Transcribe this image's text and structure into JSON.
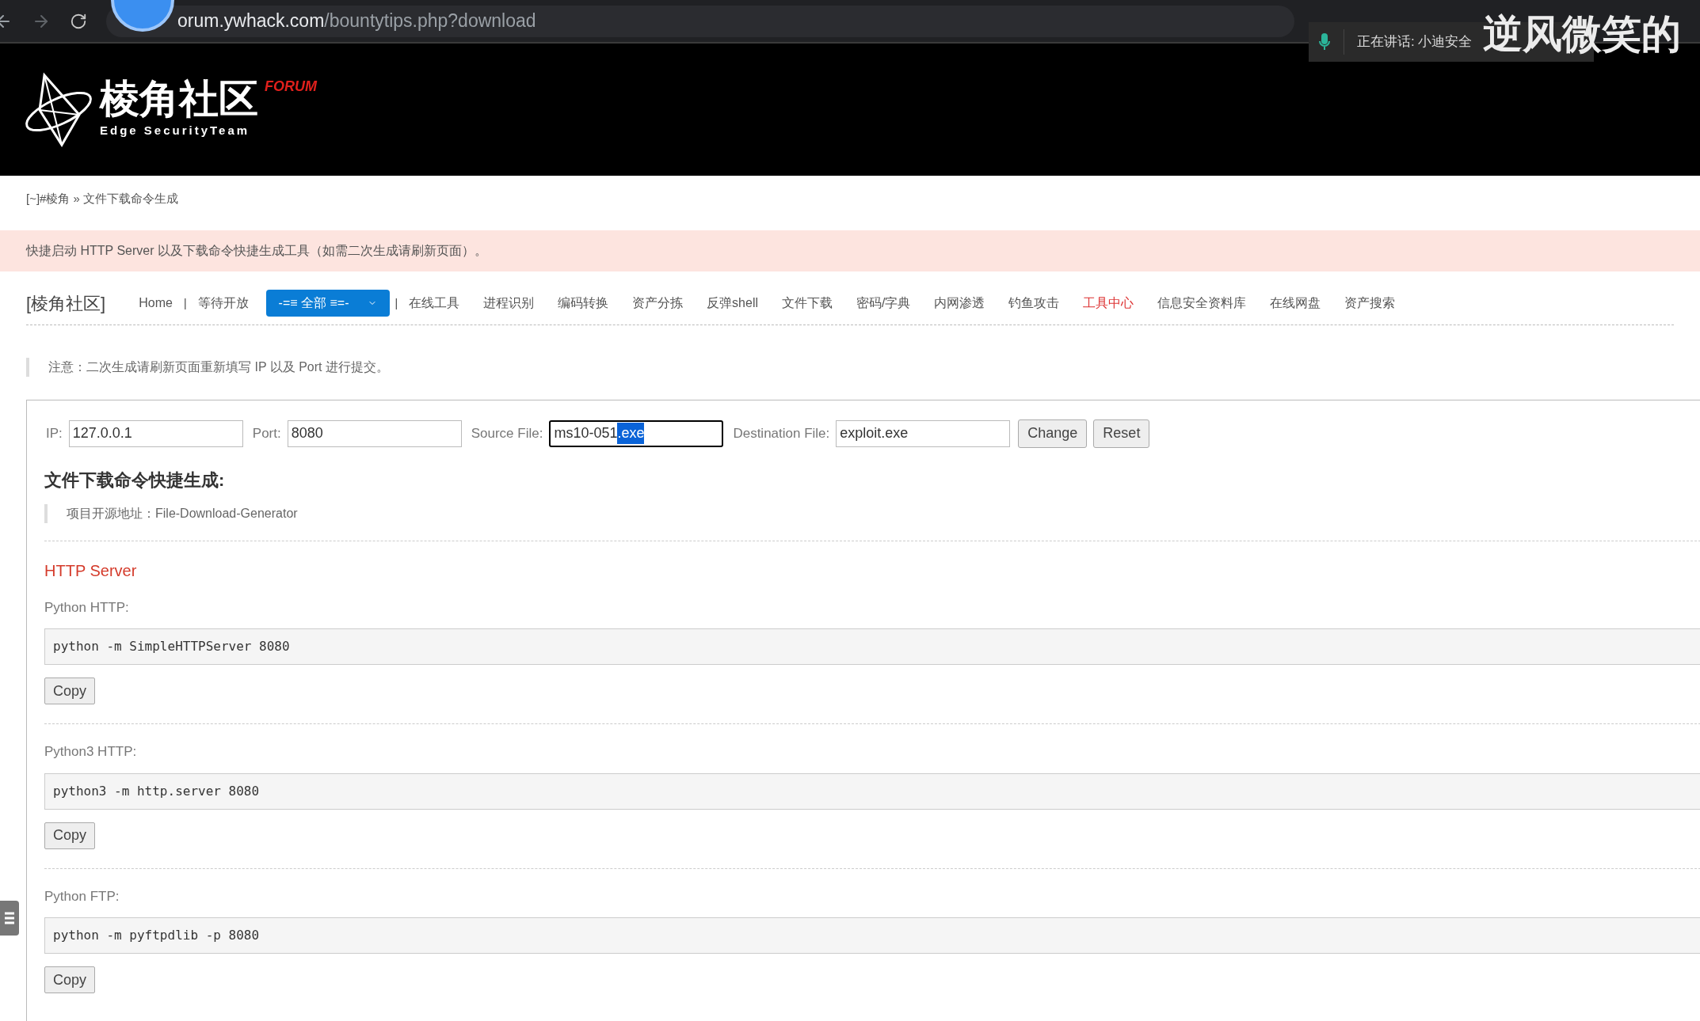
{
  "browser": {
    "url_host": "orum.ywhack.com",
    "url_path": "/bountytips.php?download"
  },
  "call_overlay": {
    "status": "正在讲话: 小迪安全",
    "caption": "逆风微笑的"
  },
  "header": {
    "logo_title": "棱角社区",
    "logo_badge": "FORUM",
    "logo_subtitle": "Edge SecurityTeam"
  },
  "breadcrumb": "[~]#棱角 » 文件下载命令生成",
  "notice": "快捷启动 HTTP Server 以及下载命令快捷生成工具（如需二次生成请刷新页面）。",
  "nav": {
    "brand": "[棱角社区]",
    "items": [
      {
        "kind": "link",
        "label": "Home",
        "selected": false
      },
      {
        "kind": "separator",
        "label": "|"
      },
      {
        "kind": "link",
        "label": "等待开放",
        "selected": false
      },
      {
        "kind": "dropdown",
        "label": "-=≡ 全部 ≡=-"
      },
      {
        "kind": "separator",
        "label": "|"
      },
      {
        "kind": "link",
        "label": "在线工具",
        "selected": false
      },
      {
        "kind": "link",
        "label": "进程识别",
        "selected": false
      },
      {
        "kind": "link",
        "label": "编码转换",
        "selected": false
      },
      {
        "kind": "link",
        "label": "资产分拣",
        "selected": false
      },
      {
        "kind": "link",
        "label": "反弹shell",
        "selected": false
      },
      {
        "kind": "link",
        "label": "文件下载",
        "selected": false
      },
      {
        "kind": "link",
        "label": "密码/字典",
        "selected": false
      },
      {
        "kind": "link",
        "label": "内网渗透",
        "selected": false
      },
      {
        "kind": "link",
        "label": "钓鱼攻击",
        "selected": false
      },
      {
        "kind": "link",
        "label": "工具中心",
        "selected": true
      },
      {
        "kind": "link",
        "label": "信息安全资料库",
        "selected": false
      },
      {
        "kind": "link",
        "label": "在线网盘",
        "selected": false
      },
      {
        "kind": "link",
        "label": "资产搜索",
        "selected": false
      }
    ]
  },
  "note": "注意：二次生成请刷新页面重新填写 IP 以及 Port 进行提交。",
  "form": {
    "fields": [
      {
        "label": "IP:",
        "value": "127.0.0.1",
        "focused": false
      },
      {
        "label": "Port:",
        "value": "8080",
        "focused": false
      },
      {
        "label": "Source File:",
        "value": "ms10-051",
        "selected_text": ".exe",
        "focused": true
      },
      {
        "label": "Destination File:",
        "value": "exploit.exe",
        "focused": false
      }
    ],
    "buttons": [
      "Change",
      "Reset"
    ]
  },
  "generator": {
    "title": "文件下载命令快捷生成:",
    "project": "项目开源地址：File-Download-Generator"
  },
  "section_title": "HTTP Server",
  "commands": [
    {
      "label": "Python HTTP:",
      "code": "python -m SimpleHTTPServer 8080",
      "button": "Copy"
    },
    {
      "label": "Python3 HTTP:",
      "code": "python3 -m http.server 8080",
      "button": "Copy"
    },
    {
      "label": "Python FTP:",
      "code": "python -m pyftpdlib -p 8080",
      "button": "Copy"
    }
  ]
}
